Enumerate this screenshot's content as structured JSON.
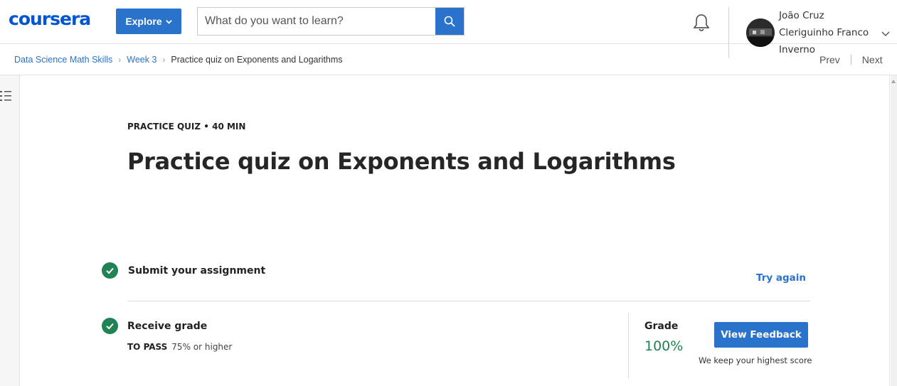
{
  "header": {
    "logo_text": "coursera",
    "explore_label": "Explore",
    "search_placeholder": "What do you want to learn?",
    "user": {
      "line1": "João Cruz",
      "line2": "Clerig­uinho Franco",
      "line3": "Inverno"
    }
  },
  "breadcrumb": {
    "items": [
      "Data Science Math Skills",
      "Week 3"
    ],
    "current": "Practice quiz on Exponents and Logarithms",
    "prev": "Prev",
    "next": "Next"
  },
  "quiz": {
    "kicker": "PRACTICE QUIZ • 40 MIN",
    "title": "Practice quiz on Exponents and Logarithms",
    "steps": {
      "submit": "Submit your assignment",
      "try_again": "Try again",
      "receive": "Receive grade",
      "to_pass_label": "TO PASS",
      "to_pass_value": "75% or higher"
    },
    "grade": {
      "label": "Grade",
      "value": "100%",
      "button": "View Feedback",
      "note": "We keep your highest score"
    }
  },
  "colors": {
    "brand": "#0056d2",
    "primary_button": "#2a73cc",
    "success": "#1f8354"
  },
  "icons": [
    "search-icon",
    "bell-icon",
    "chevron-down-icon",
    "menu-list-icon",
    "check-circle-icon"
  ]
}
